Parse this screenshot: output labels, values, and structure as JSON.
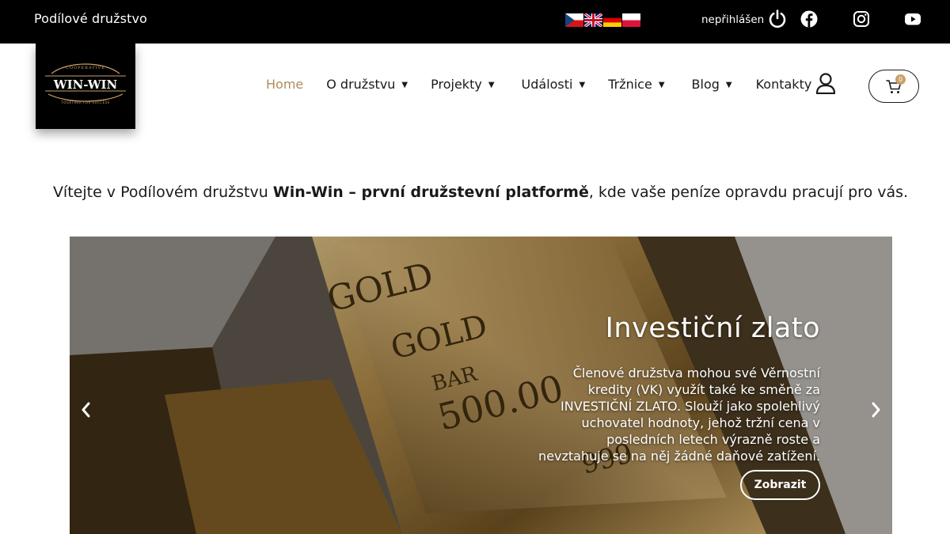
{
  "topbar": {
    "site_title": "Podílové družstvo",
    "languages": [
      "cs-flag-icon",
      "uk-flag-icon",
      "de-flag-icon",
      "pl-flag-icon"
    ],
    "login_status": "nepřihlášen",
    "icons": [
      "power-icon",
      "facebook-icon",
      "instagram-icon",
      "youtube-icon"
    ]
  },
  "logo": {
    "top_text": "COOPERATIVE",
    "name": "WIN-WIN",
    "bottom_text": "TOGETHER FOR SUCCESS"
  },
  "nav": {
    "items": [
      {
        "label": "Home",
        "active": true,
        "dropdown": false
      },
      {
        "label": "O družstvu",
        "active": false,
        "dropdown": true
      },
      {
        "label": "Projekty",
        "active": false,
        "dropdown": true
      },
      {
        "label": "Události",
        "active": false,
        "dropdown": true
      },
      {
        "label": "Tržnice",
        "active": false,
        "dropdown": true
      },
      {
        "label": "Blog",
        "active": false,
        "dropdown": true
      },
      {
        "label": "Kontakty",
        "active": false,
        "dropdown": false
      }
    ],
    "caret": "▼",
    "cart_count": "0"
  },
  "welcome": {
    "prefix": "Vítejte v Podílovém družstvu ",
    "bold": "Win-Win – první družstevní platformě",
    "suffix": ", kde vaše peníze opravdu pracují pro vás."
  },
  "hero": {
    "title": "Investiční zlato",
    "description": "Členové družstva mohou své Věrnostní kredity (VK) využít také ke směně za INVESTIČNÍ ZLATO. Slouží jako spolehlivý uchovatel hodnoty, jehož tržní cena v posledních letech výrazně roste a nevztahuje se na něj žádné daňové zatížení.",
    "button_label": "Zobrazit",
    "bar_text": {
      "word1": "GOLD",
      "word2": "GOLD",
      "word3": "BAR",
      "weight": "500.00",
      "purity": "999"
    }
  },
  "colors": {
    "accent": "#b08b5b",
    "cart_badge": "#c9a06a",
    "topbar": "#000000"
  }
}
